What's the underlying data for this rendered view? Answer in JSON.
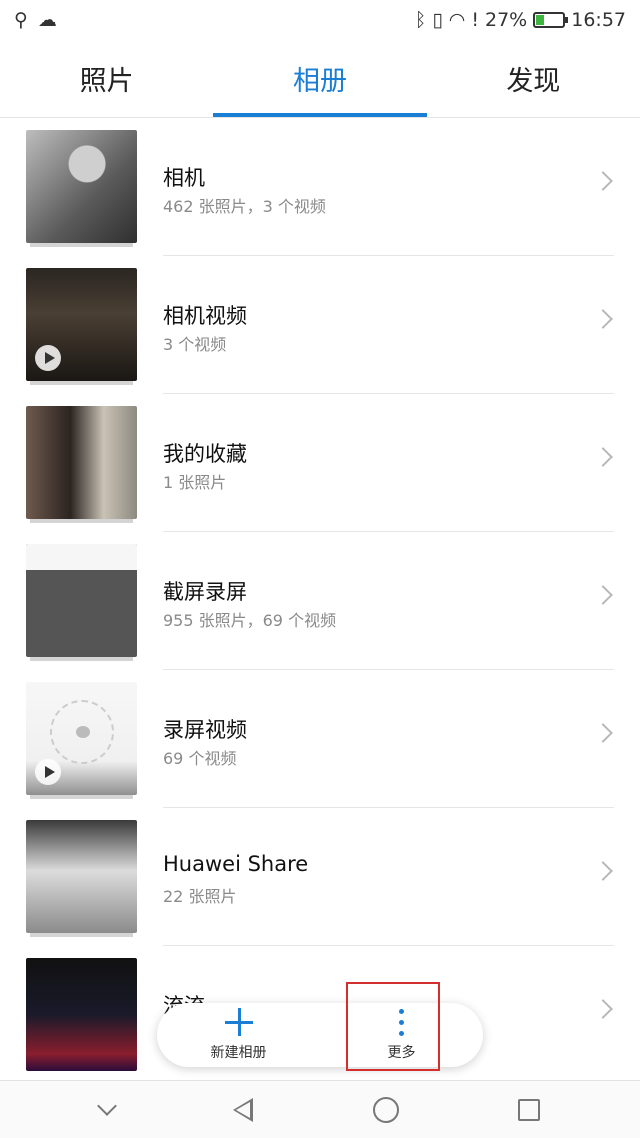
{
  "status": {
    "battery_percent": "27%",
    "battery_level": 0.27,
    "time": "16:57",
    "icons": [
      "usb-icon",
      "cloud-icon",
      "bluetooth-icon",
      "vibrate-icon",
      "wifi-icon",
      "battery-alert-icon",
      "battery-icon"
    ]
  },
  "tabs": [
    {
      "label": "照片",
      "active": false
    },
    {
      "label": "相册",
      "active": true
    },
    {
      "label": "发现",
      "active": false
    }
  ],
  "albums": [
    {
      "name": "相机",
      "count": "462 张照片，3 个视频",
      "video": false
    },
    {
      "name": "相机视频",
      "count": "3 个视频",
      "video": true
    },
    {
      "name": "我的收藏",
      "count": "1 张照片",
      "video": false
    },
    {
      "name": "截屏录屏",
      "count": "955 张照片，69 个视频",
      "video": false
    },
    {
      "name": "录屏视频",
      "count": "69 个视频",
      "video": true
    },
    {
      "name": "Huawei Share",
      "count": "22 张照片",
      "video": false
    },
    {
      "name": "流流",
      "count": "",
      "video": false
    }
  ],
  "actions": {
    "new_album": "新建相册",
    "more": "更多"
  },
  "colors": {
    "accent": "#1a7fd4",
    "highlight": "#d32f2f"
  }
}
